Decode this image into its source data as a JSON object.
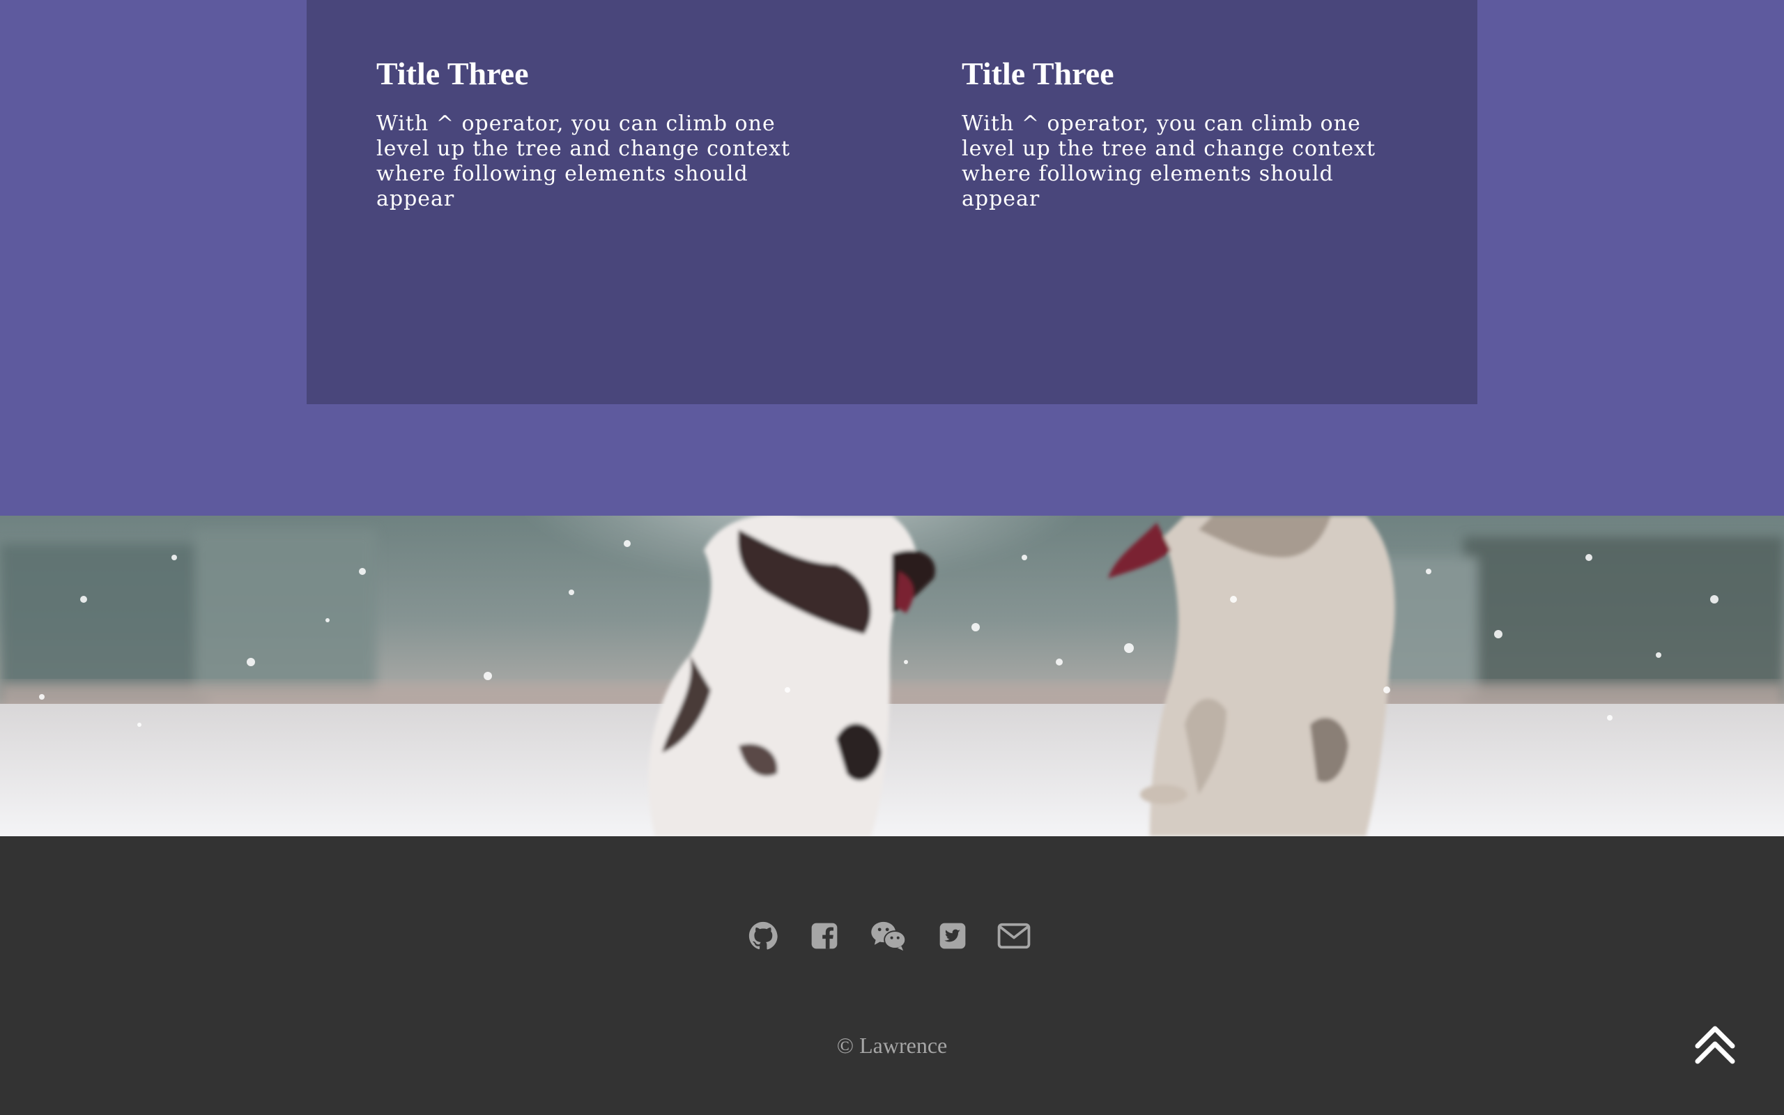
{
  "cards": [
    {
      "title": "Title Three",
      "body": "With ^ operator, you can climb one level up the tree and change context where following elements should appear"
    },
    {
      "title": "Title Three",
      "body": "With ^ operator, you can climb one level up the tree and change context where following elements should appear"
    }
  ],
  "hero": {
    "subject": "two husky puppies playing in snow"
  },
  "footer": {
    "social": [
      {
        "name": "github-icon"
      },
      {
        "name": "facebook-icon"
      },
      {
        "name": "wechat-icon"
      },
      {
        "name": "twitter-icon"
      },
      {
        "name": "mail-icon"
      }
    ],
    "copyright": "© Lawrence",
    "back_to_top_icon": "double-chevron-up-icon"
  },
  "colors": {
    "page_background": "#5e5a9e",
    "card_panel": "#49467b",
    "footer_background": "#333333",
    "icon_color": "#a6a6a6",
    "text_light": "#ffffff"
  }
}
